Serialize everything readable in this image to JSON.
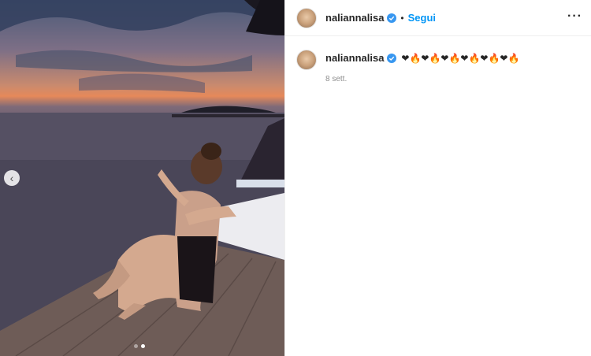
{
  "post": {
    "username": "naliannalisa",
    "follow_label": "Segui",
    "separator": "•",
    "more_label": "···",
    "caption": "❤🔥❤🔥❤🔥❤🔥❤🔥❤🔥",
    "timestamp": "8 sett.",
    "verified_color": "#3897f0",
    "accent_color": "#0095f6"
  },
  "carousel": {
    "prev_icon": "chevron-left-icon",
    "prev_glyph": "‹",
    "slide_count": 2,
    "active_slide": 2
  }
}
